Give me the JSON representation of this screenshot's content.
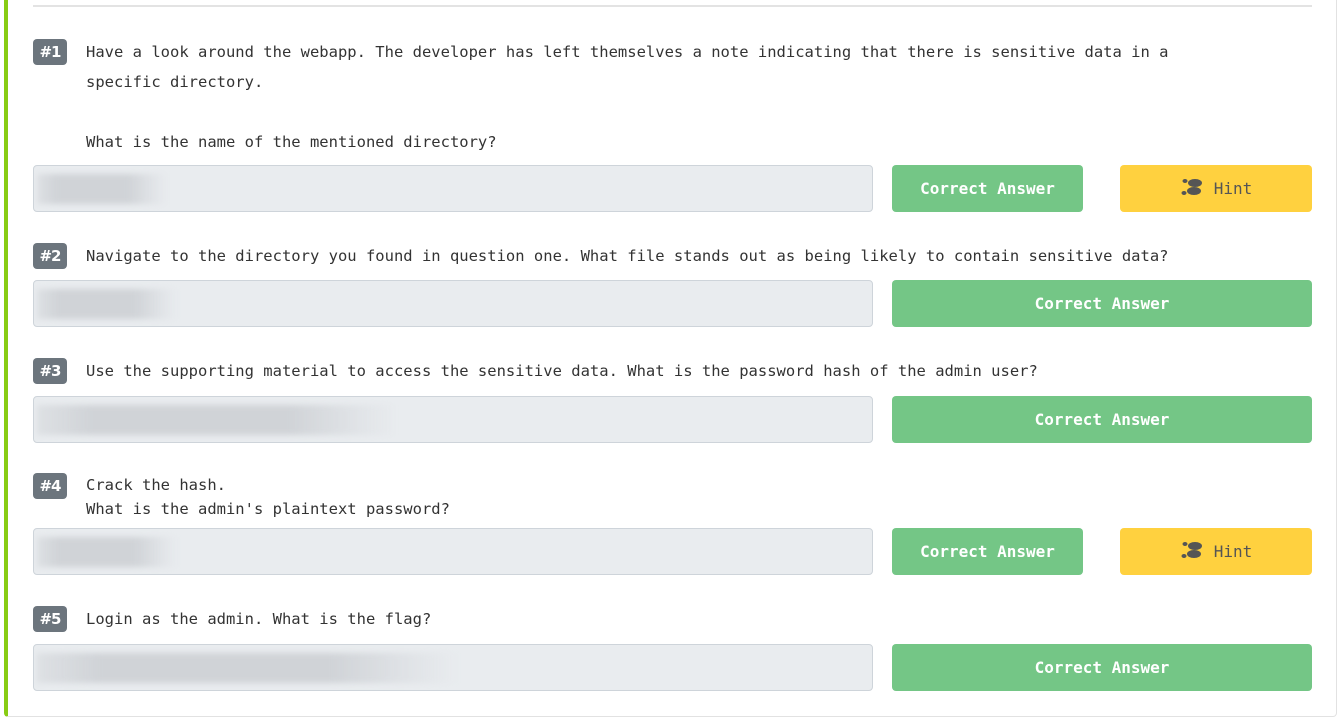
{
  "colors": {
    "accent_border": "#88cc14",
    "correct_button": "#74c686",
    "hint_button": "#ffd13f",
    "badge": "#6c757d",
    "answer_field": "#e9ecef"
  },
  "tasks": [
    {
      "number": "#1",
      "question": "Have a look around the webapp. The developer has left themselves a note indicating that there is sensitive data in a\nspecific directory.\n\nWhat is the name of the mentioned directory?",
      "answer_state": "blurred",
      "correct_label": "Correct Answer",
      "hint_label": "Hint",
      "hint_icon": "footprints-icon"
    },
    {
      "number": "#2",
      "question": "Navigate to the directory you found in question one. What file stands out as being likely to contain sensitive data?",
      "answer_state": "blurred",
      "correct_label": "Correct Answer"
    },
    {
      "number": "#3",
      "question": "Use the supporting material to access the sensitive data. What is the password hash of the admin user?",
      "answer_state": "blurred",
      "correct_label": "Correct Answer"
    },
    {
      "number": "#4",
      "question": "Crack the hash.\nWhat is the admin's plaintext password?",
      "answer_state": "blurred",
      "correct_label": "Correct Answer",
      "hint_label": "Hint",
      "hint_icon": "footprints-icon"
    },
    {
      "number": "#5",
      "question": "Login as the admin. What is the flag?",
      "answer_state": "blurred",
      "correct_label": "Correct Answer"
    }
  ]
}
